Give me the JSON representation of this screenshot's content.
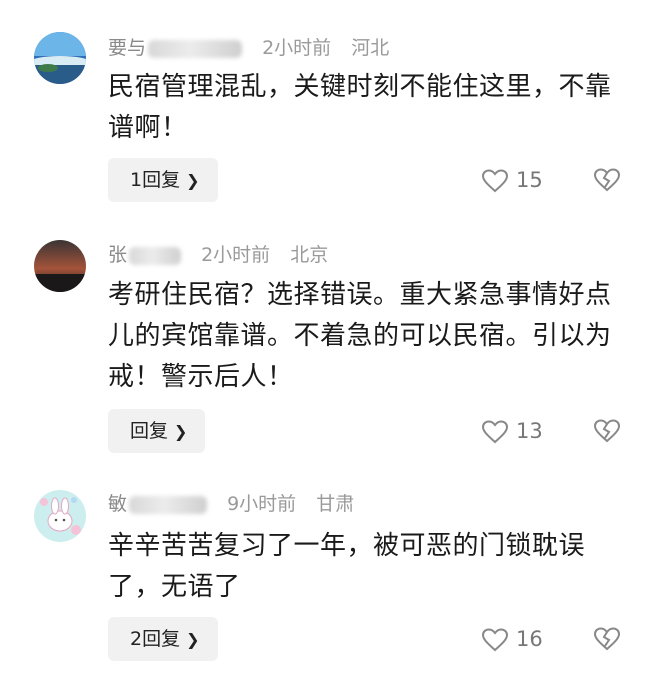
{
  "comments": [
    {
      "username": "要与",
      "time": "2小时前",
      "location": "河北",
      "text": "民宿管理混乱，关键时刻不能住这里，不靠谱啊！",
      "reply_label": "1回复",
      "likes": "15",
      "avatar_colors": [
        "#3e7fbf",
        "#6fb2e3"
      ]
    },
    {
      "username": "张",
      "time": "2小时前",
      "location": "北京",
      "text": "考研住民宿？选择错误。重大紧急事情好点儿的宾馆靠谱。不着急的可以民宿。引以为戒！警示后人！",
      "reply_label": "回复",
      "likes": "13",
      "avatar_colors": [
        "#2d2a2a",
        "#b55a3a"
      ]
    },
    {
      "username": "敏",
      "time": "9小时前",
      "location": "甘肃",
      "text": "辛辛苦苦复习了一年，被可恶的门锁耽误了，无语了",
      "reply_label": "2回复",
      "likes": "16",
      "avatar_colors": [
        "#c9ecec",
        "#f3c1d7"
      ]
    }
  ],
  "icons": {
    "reply_chevron": "chevron-right-icon",
    "like": "heart-outline-icon",
    "dislike": "broken-heart-icon"
  }
}
